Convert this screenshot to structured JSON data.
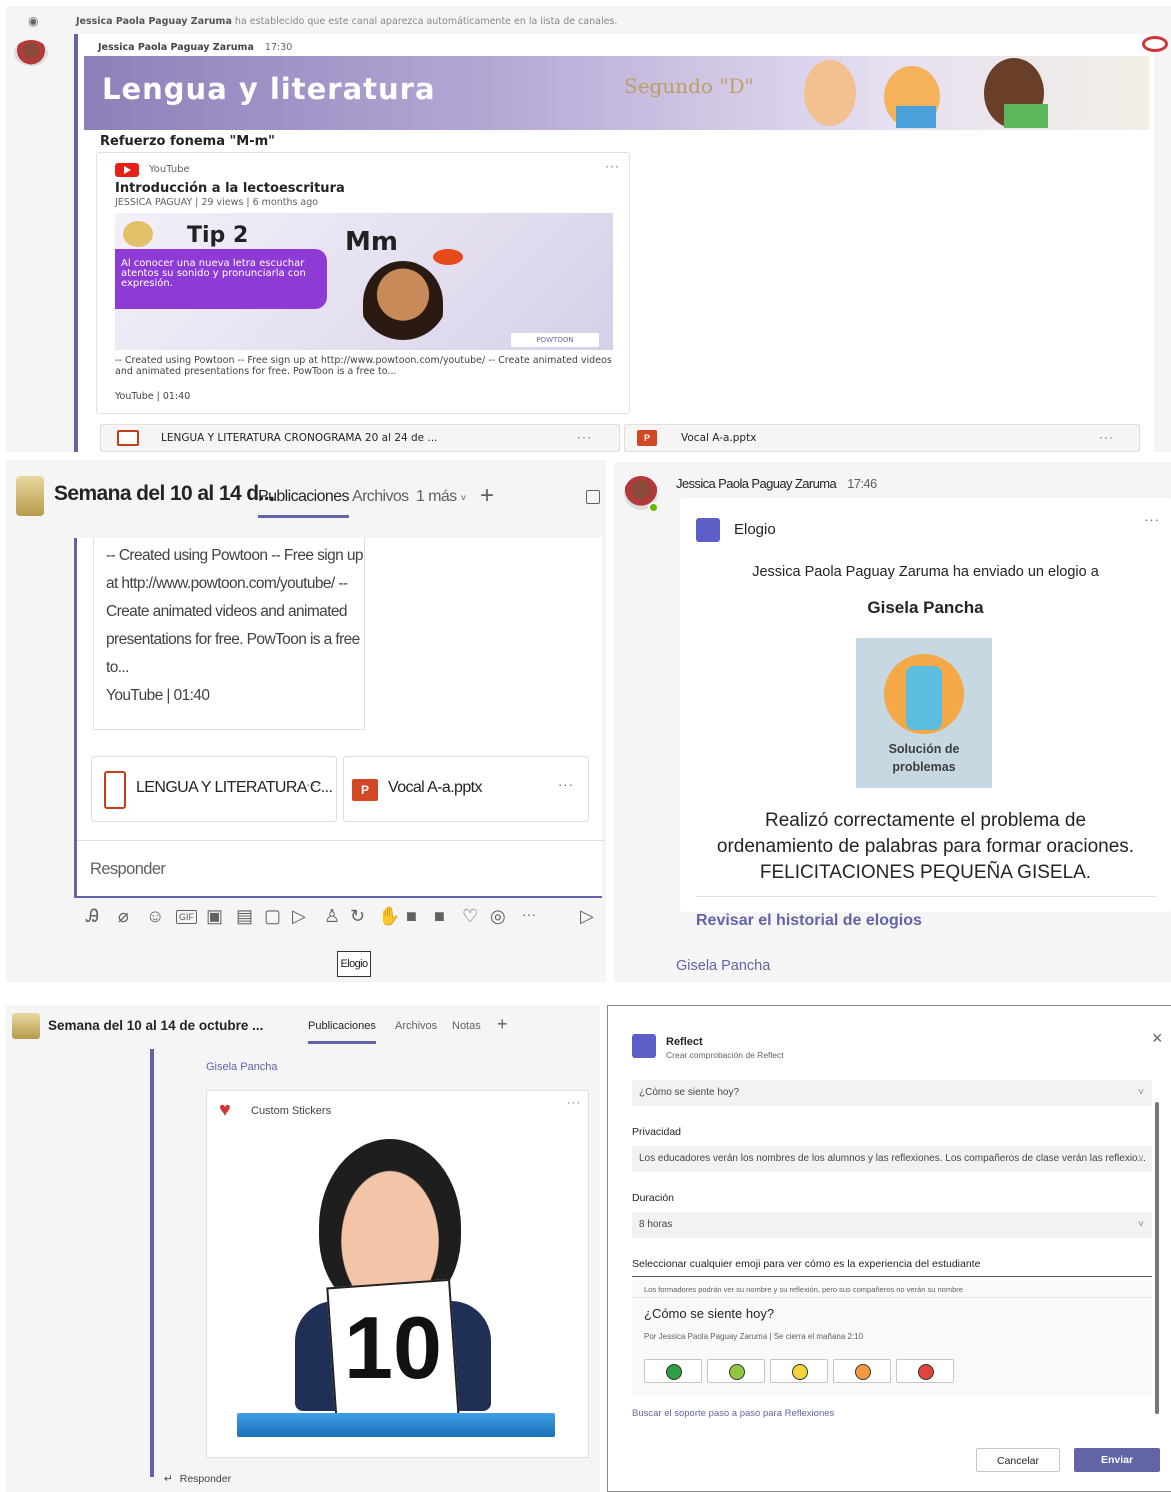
{
  "panel1": {
    "system_line_author": "Jessica Paola Paguay Zaruma",
    "system_line_text": "ha establecido que este canal aparezca automáticamente en la lista de canales.",
    "author": "Jessica Paola Paguay Zaruma",
    "time": "17:30",
    "banner_title": "Lengua y literatura",
    "banner_grade": "Segundo \"D\"",
    "subject": "Refuerzo fonema \"M-m\"",
    "youtube": {
      "source": "YouTube",
      "title": "Introducción a la lectoescritura",
      "meta": "JESSICA PAGUAY | 29 views | 6 months ago",
      "thumb_tip": "Tip 2",
      "thumb_mm": "Mm",
      "thumb_text": "Al conocer una nueva letra escuchar atentos su sonido y pronunciarla con expresión.",
      "thumb_brand": "POWTOON",
      "description": "-- Created using Powtoon -- Free sign up at http://www.powtoon.com/youtube/ -- Create animated videos and animated presentations for free. PowToon is a free to...",
      "footer": "YouTube | 01:40"
    },
    "attachments": [
      {
        "name": "LENGUA Y LITERATURA CRONOGRAMA 20 al 24 de ...",
        "more": "···"
      },
      {
        "name": "Vocal A-a.pptx",
        "more": "···"
      }
    ]
  },
  "panel2": {
    "channel_title": "Semana del 10 al 14 d...",
    "tabs": [
      "Publicaciones",
      "Archivos",
      "1 más"
    ],
    "add": "+",
    "description_lines": [
      "-- Created using Powtoon -- Free sign up",
      "at http://www.powtoon.com/youtube/ --",
      "Create animated videos and animated",
      "presentations for free. PowToon is a free",
      "to...",
      "YouTube | 01:40"
    ],
    "attachments": [
      {
        "name": "LENGUA Y LITERATURA C...",
        "more": "···"
      },
      {
        "name": "Vocal A-a.pptx",
        "more": "···"
      }
    ],
    "reply": "Responder",
    "tooltip": "Elogio"
  },
  "panel3": {
    "author": "Jessica Paola Paguay Zaruma",
    "time": "17:46",
    "card_type": "Elogio",
    "sent_line": "Jessica Paola Paguay Zaruma ha enviado un elogio a",
    "recipient": "Gisela Pancha",
    "badge_label": "Solución de problemas",
    "message_lines": [
      "Realizó correctamente el problema de",
      "ordenamiento de palabras para formar oraciones.",
      "FELICITACIONES PEQUEÑA GISELA."
    ],
    "history_link": "Revisar el historial de elogios",
    "footer_name": "Gisela Pancha",
    "more": "···"
  },
  "panel4": {
    "channel_title": "Semana del 10 al 14 de octubre ...",
    "tabs": [
      "Publicaciones",
      "Archivos",
      "Notas"
    ],
    "add": "+",
    "mention": "Gisela Pancha",
    "sticker_source": "Custom Stickers",
    "sticker_number": "10",
    "reply": "Responder",
    "more": "···"
  },
  "panel5": {
    "app_name": "Reflect",
    "app_subtitle": "Crear comprobación de Reflect",
    "question_select": "¿Cómo se siente hoy?",
    "privacy_label": "Privacidad",
    "privacy_value": "Los educadores verán los nombres de los alumnos y las reflexiones. Los compañeros de clase verán las reflexio...",
    "duration_label": "Duración",
    "duration_value": "8 horas",
    "emoji_label": "Seleccionar cualquier emoji para ver cómo es la experiencia del estudiante",
    "preview_note": "Los formadores podrán ver su nombre y su reflexión, pero sus compañeros no verán su nombre",
    "preview_question": "¿Cómo se siente hoy?",
    "preview_meta": "Por Jessica Paola Paguay Zaruma  |  Se cierra el mañana 2:10",
    "emoji_colors": [
      "#2e9e44",
      "#92c840",
      "#f5d33b",
      "#f39a3c",
      "#e0453d"
    ],
    "support_link": "Buscar el soporte paso a paso para Reflexiones",
    "cancel": "Cancelar",
    "send": "Enviar",
    "close": "×"
  }
}
